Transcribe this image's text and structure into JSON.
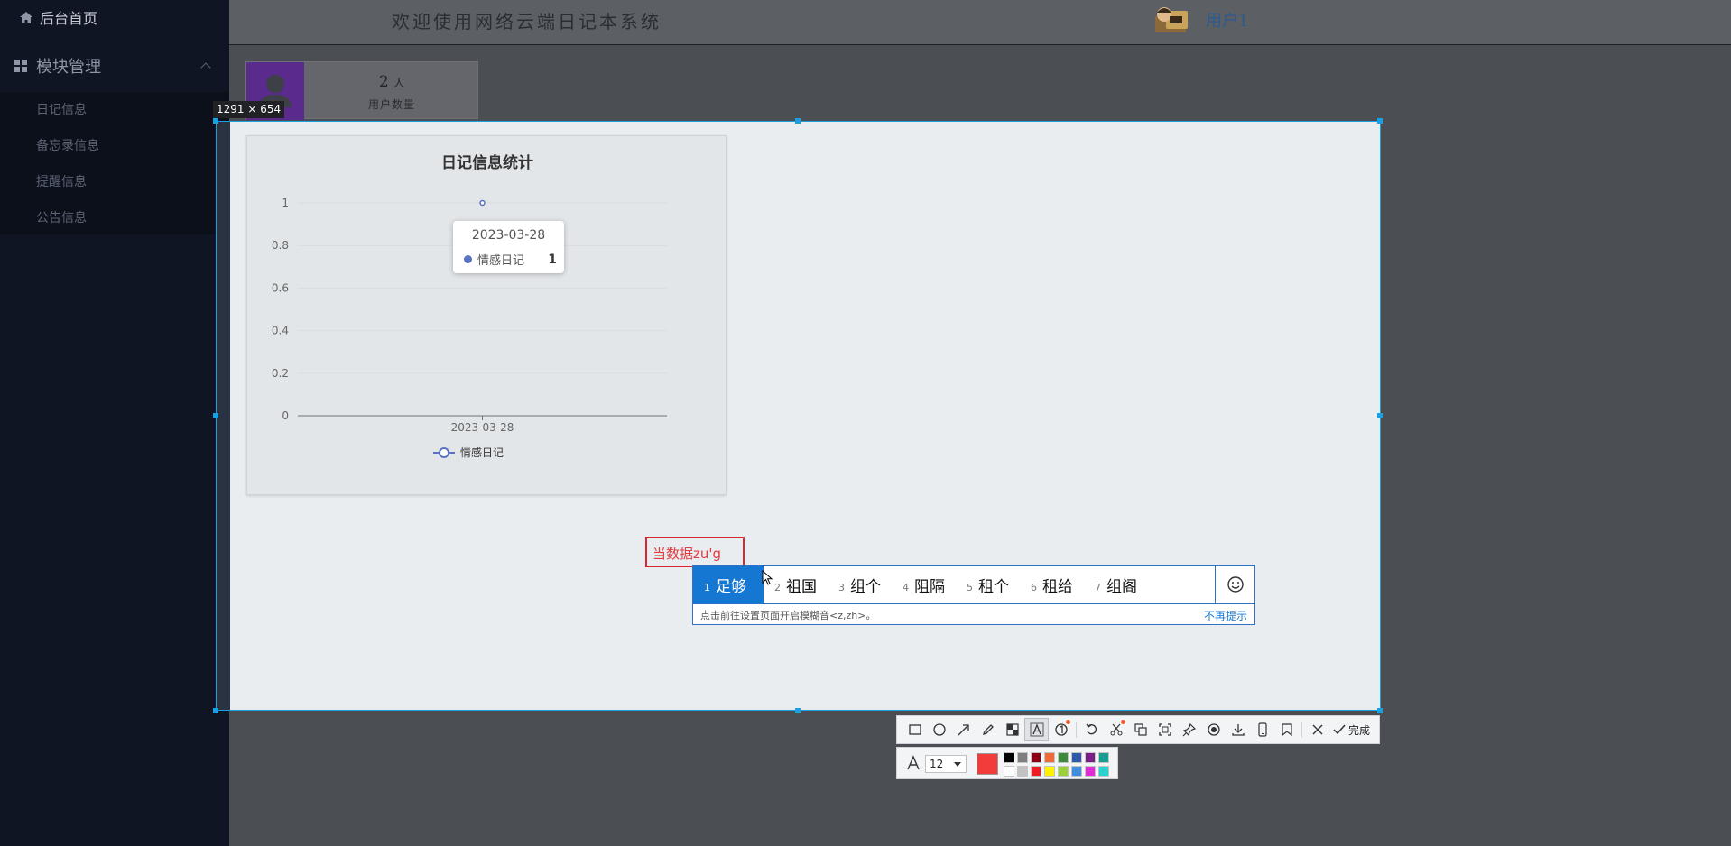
{
  "sidebar": {
    "home_label": "后台首页",
    "group_label": "模块管理",
    "items": [
      {
        "label": "日记信息"
      },
      {
        "label": "备忘录信息"
      },
      {
        "label": "提醒信息"
      },
      {
        "label": "公告信息"
      }
    ]
  },
  "header": {
    "title": "欢迎使用网络云端日记本系统",
    "user": "用户1"
  },
  "stat_card": {
    "value": "2",
    "unit": "人",
    "label": "用户数量"
  },
  "selection": {
    "size_label": "1291 × 654"
  },
  "chart_data": {
    "type": "line",
    "title": "日记信息统计",
    "categories": [
      "2023-03-28"
    ],
    "series": [
      {
        "name": "情感日记",
        "values": [
          1
        ],
        "color": "#5a72c2"
      }
    ],
    "ylim": [
      0,
      1
    ],
    "yticks": [
      "0",
      "0.2",
      "0.4",
      "0.6",
      "0.8",
      "1"
    ],
    "grid": true,
    "legend": "bottom",
    "tooltip": {
      "date": "2023-03-28",
      "series": "情感日记",
      "value": "1"
    }
  },
  "annotation": {
    "text": "当数据zu'g"
  },
  "ime": {
    "candidates": [
      {
        "n": "1",
        "text": "足够"
      },
      {
        "n": "2",
        "text": "祖国"
      },
      {
        "n": "3",
        "text": "组个"
      },
      {
        "n": "4",
        "text": "阻隔"
      },
      {
        "n": "5",
        "text": "租个"
      },
      {
        "n": "6",
        "text": "租给"
      },
      {
        "n": "7",
        "text": "组阁"
      }
    ],
    "hint": "点击前往设置页面开启模糊音<z,zh>。",
    "dismiss": "不再提示"
  },
  "toolbar": {
    "done_label": "完成",
    "font_size": "12",
    "current_color": "#f23b3b",
    "palette": [
      "#000000",
      "#7f7f7f",
      "#880015",
      "#ed6b3a",
      "#3c8a3a",
      "#2f5aa8",
      "#7a1f86",
      "#1a9c93",
      "#ffffff",
      "#c3c3c3",
      "#ed1c24",
      "#fff200",
      "#9bd138",
      "#3f8cdc",
      "#e22ad6",
      "#2ad1d1"
    ]
  }
}
